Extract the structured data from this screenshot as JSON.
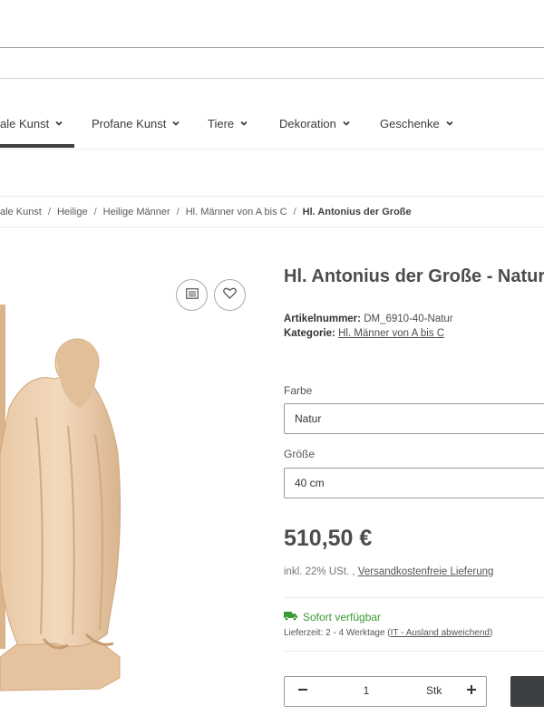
{
  "nav": {
    "items": [
      {
        "label": "ale Kunst"
      },
      {
        "label": "Profane Kunst"
      },
      {
        "label": "Tiere"
      },
      {
        "label": "Dekoration"
      },
      {
        "label": "Geschenke"
      }
    ]
  },
  "breadcrumb": {
    "items": [
      "ale Kunst",
      "Heilige",
      "Heilige Männer",
      "Hl. Männer von A bis C"
    ],
    "current": "Hl. Antonius der Große"
  },
  "product": {
    "title": "Hl. Antonius der Große - Natur",
    "sku_label": "Artikelnummer:",
    "sku_value": "DM_6910-40-Natur",
    "category_label": "Kategorie:",
    "category_value": "Hl. Männer von A bis C",
    "color_label": "Farbe",
    "color_value": "Natur",
    "size_label": "Größe",
    "size_value": "40 cm",
    "price": "510,50 €",
    "tax_text": "inkl. 22% USt. , ",
    "shipping_link": "Versandkostenfreie Lieferung",
    "availability": "Sofort verfügbar",
    "delivery_prefix": "Lieferzeit: 2 - 4 Werktage (",
    "delivery_link": "IT - Ausland abweichend",
    "delivery_suffix": ")",
    "quantity": "1",
    "unit": "Stk"
  },
  "colors": {
    "in_stock": "#3c9a35",
    "dark_button": "#3c4043"
  },
  "icons": [
    "chevron-down-icon",
    "compare-list-icon",
    "heart-icon",
    "truck-icon",
    "minus-icon",
    "plus-icon"
  ]
}
